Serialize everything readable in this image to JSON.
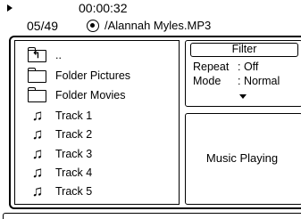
{
  "status": {
    "play_icon": "play-triangle-icon",
    "time": "00:00:32",
    "counter": "05/49",
    "disc_icon": "disc-icon",
    "file": "/Alannah Myles.MP3"
  },
  "browser": {
    "items": [
      {
        "icon": "folder-up-icon",
        "label": ".."
      },
      {
        "icon": "folder-icon",
        "label": "Folder Pictures"
      },
      {
        "icon": "folder-icon",
        "label": "Folder Movies"
      },
      {
        "icon": "music-note-icon",
        "label": "Track 1"
      },
      {
        "icon": "music-note-icon",
        "label": "Track 2"
      },
      {
        "icon": "music-note-icon",
        "label": "Track 3"
      },
      {
        "icon": "music-note-icon",
        "label": "Track 4"
      },
      {
        "icon": "music-note-icon",
        "label": "Track 5"
      }
    ]
  },
  "filter": {
    "title": "Filter",
    "repeat_label": "Repeat",
    "repeat_value": ": Off",
    "mode_label": "Mode",
    "mode_value": ": Normal"
  },
  "info": {
    "text": "Music Playing"
  }
}
